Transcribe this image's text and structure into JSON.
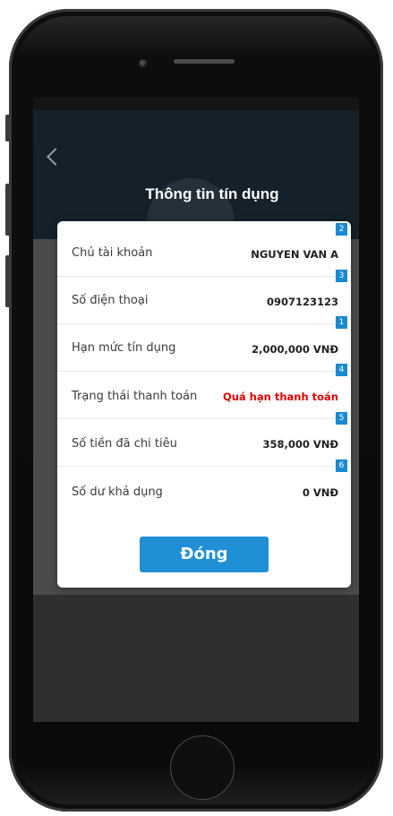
{
  "screen": {
    "title": "Thông tin tín dụng"
  },
  "dialog": {
    "rows": [
      {
        "label": "Chủ tài khoản",
        "value": "NGUYEN VAN A",
        "badge": "2"
      },
      {
        "label": "Số điện thoại",
        "value": "0907123123",
        "badge": "3"
      },
      {
        "label": "Hạn mức tín dụng",
        "value": "2,000,000 VNĐ",
        "badge": "1"
      },
      {
        "label": "Trạng thái thanh toán",
        "value": "Quá hạn thanh toán",
        "badge": "4"
      },
      {
        "label": "Số tiền đã chi tiêu",
        "value": "358,000 VNĐ",
        "badge": "5"
      },
      {
        "label": "Số dư khả dụng",
        "value": "0 VNĐ",
        "badge": "6"
      }
    ],
    "close_label": "Đóng"
  },
  "colors": {
    "accent": "#1f8fd6",
    "badge": "#1b88d2",
    "overdue": "#e00000",
    "header_dark": "#14212b"
  },
  "icons": {
    "back": "chevron-left-icon"
  }
}
